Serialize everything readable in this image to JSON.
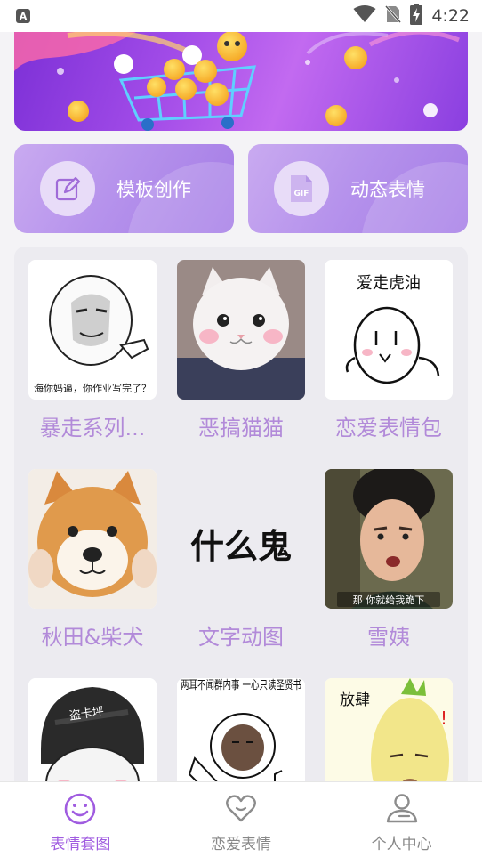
{
  "status_bar": {
    "app_icon_letter": "A",
    "time": "4:22"
  },
  "features": [
    {
      "label": "模板创作",
      "icon": "edit-icon"
    },
    {
      "label": "动态表情",
      "icon": "gif-icon"
    }
  ],
  "grid": {
    "items": [
      {
        "label": "暴走系列...",
        "caption": "海你妈逼，你作业写完了？"
      },
      {
        "label": "恶搞猫猫",
        "caption": ""
      },
      {
        "label": "恋爱表情包",
        "caption": "爱走虎油"
      },
      {
        "label": "秋田&柴犬",
        "caption": ""
      },
      {
        "label": "文字动图",
        "caption": "什么鬼"
      },
      {
        "label": "雪姨",
        "caption": "那 你就给我跪下"
      },
      {
        "label": "",
        "caption": "盗卡坪"
      },
      {
        "label": "",
        "caption": "两耳不闻群内事 一心只读圣贤书"
      },
      {
        "label": "",
        "caption": "放肆"
      }
    ]
  },
  "bottom_nav": {
    "items": [
      {
        "label": "表情套图",
        "icon": "smiley-icon",
        "active": true
      },
      {
        "label": "恋爱表情",
        "icon": "heart-icon",
        "active": false
      },
      {
        "label": "个人中心",
        "icon": "person-icon",
        "active": false
      }
    ]
  },
  "colors": {
    "accent": "#a05ce0",
    "label_purple": "#b28ad9",
    "inactive": "#888888"
  }
}
